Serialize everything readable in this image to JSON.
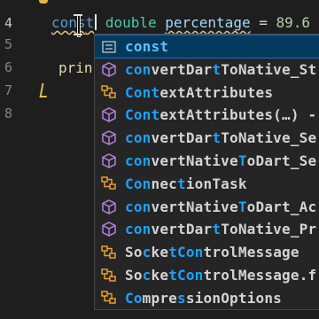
{
  "editor": {
    "line_numbers": [
      {
        "n": "4",
        "active": true
      },
      {
        "n": "5",
        "active": false
      },
      {
        "n": "6",
        "active": false
      },
      {
        "n": "7",
        "active": false
      },
      {
        "n": "8",
        "active": false
      }
    ],
    "line4": {
      "typed_prefix": "cons",
      "typed_suffix": "t",
      "keyword": "double",
      "variable": "percentage",
      "operator": " = ",
      "value": "89.6"
    },
    "line6": {
      "text": "prin"
    }
  },
  "suggestions": [
    {
      "icon": "keyword-icon",
      "pre": "",
      "match": "const",
      "post": "",
      "selected": true
    },
    {
      "icon": "method-cube-icon",
      "pre": "",
      "match": "con",
      "post": "vertDar",
      "match2": "t",
      "post2": "ToNative_St"
    },
    {
      "icon": "class-icon",
      "pre": "",
      "match": "Con",
      "post": "",
      "match2": "t",
      "post2": "extAttributes"
    },
    {
      "icon": "method-cube-icon",
      "pre": "",
      "match": "Con",
      "post": "",
      "match2": "t",
      "post2": "extAttributes(…) -"
    },
    {
      "icon": "method-cube-icon",
      "pre": "",
      "match": "con",
      "post": "vertDar",
      "match2": "t",
      "post2": "ToNative_Se"
    },
    {
      "icon": "method-cube-icon",
      "pre": "",
      "match": "con",
      "post": "vertNative",
      "match2": "T",
      "post2": "oDart_Se"
    },
    {
      "icon": "class-icon",
      "pre": "",
      "match": "Con",
      "post": "nec",
      "match2": "t",
      "post2": "ionTask"
    },
    {
      "icon": "method-cube-icon",
      "pre": "",
      "match": "con",
      "post": "vertNative",
      "match2": "T",
      "post2": "oDart_Ac"
    },
    {
      "icon": "method-cube-icon",
      "pre": "",
      "match": "con",
      "post": "vertDar",
      "match2": "t",
      "post2": "ToNative_Pr"
    },
    {
      "icon": "class-icon",
      "pre": "So",
      "match": "c",
      "post": "ke",
      "match2": "tCon",
      "post2": "trolMessage"
    },
    {
      "icon": "class-icon",
      "pre": "So",
      "match": "c",
      "post": "ke",
      "match2": "tCon",
      "post2": "trolMessage.f"
    },
    {
      "icon": "class-icon",
      "pre": "",
      "match": "Co",
      "post": "mpre",
      "match2": "s",
      "post2": "sionOptions"
    }
  ],
  "colors": {
    "background": "#1e1e1e",
    "widget": "#252526",
    "selected": "#04395e",
    "match_highlight": "#18a3ff",
    "method_icon": "#b180d7",
    "class_icon": "#ee9d28"
  }
}
